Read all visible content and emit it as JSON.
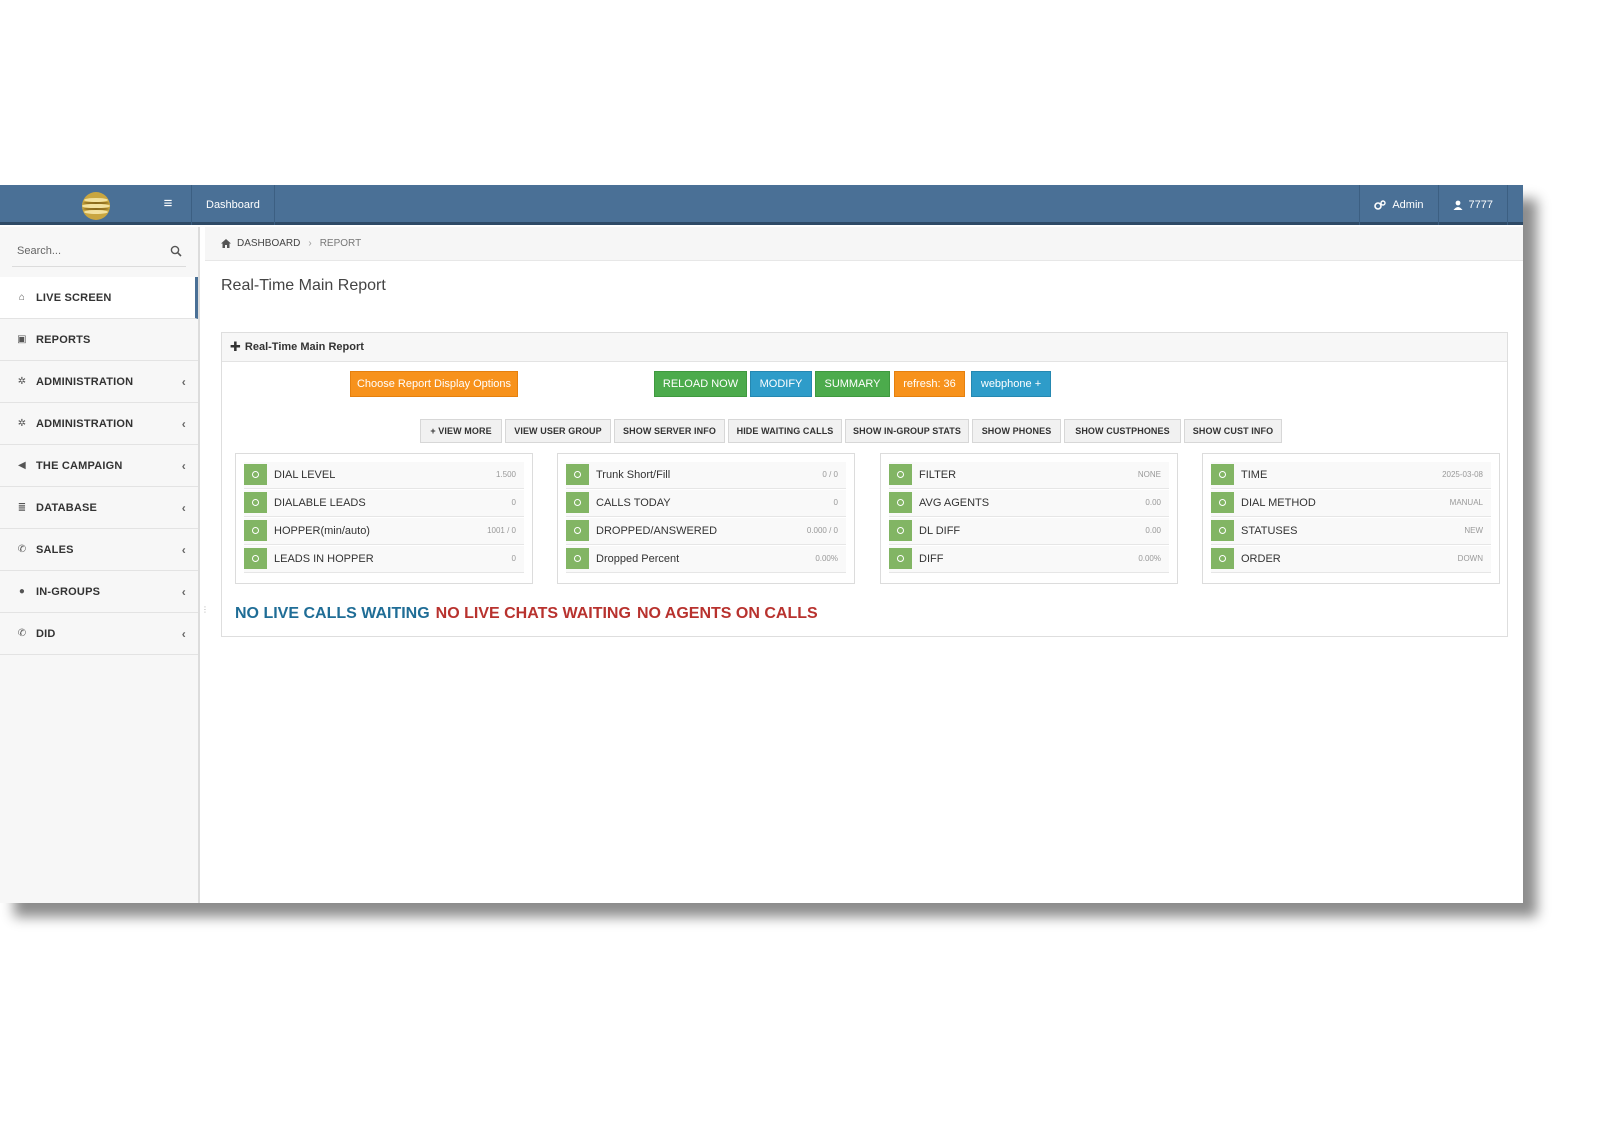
{
  "header": {
    "nav_dashboard": "Dashboard",
    "admin_label": "Admin",
    "user_label": "7777",
    "hamburger": "≡"
  },
  "sidebar": {
    "search_placeholder": "Search...",
    "items": [
      {
        "label": "LIVE SCREEN",
        "icon": "home-icon",
        "active": true,
        "chevron": false
      },
      {
        "label": "REPORTS",
        "icon": "image-icon",
        "active": false,
        "chevron": false
      },
      {
        "label": "ADMINISTRATION",
        "icon": "gear-icon",
        "active": false,
        "chevron": true
      },
      {
        "label": "ADMINISTRATION",
        "icon": "gear-icon",
        "active": false,
        "chevron": true
      },
      {
        "label": "THE CAMPAIGN",
        "icon": "bullhorn-icon",
        "active": false,
        "chevron": true
      },
      {
        "label": "DATABASE",
        "icon": "database-icon",
        "active": false,
        "chevron": true
      },
      {
        "label": "SALES",
        "icon": "phone-icon",
        "active": false,
        "chevron": true
      },
      {
        "label": "IN-GROUPS",
        "icon": "user-icon",
        "active": false,
        "chevron": true
      },
      {
        "label": "DID",
        "icon": "phone-icon",
        "active": false,
        "chevron": true
      }
    ]
  },
  "breadcrumb": {
    "home": "DASHBOARD",
    "current": "REPORT"
  },
  "page_title": "Real-Time Main Report",
  "panel": {
    "title": "Real-Time Main Report",
    "choose_options": "Choose Report Display Options",
    "reload_now": "RELOAD NOW",
    "modify": "MODIFY",
    "summary": "SUMMARY",
    "refresh": "refresh: 36",
    "webphone": "webphone +",
    "toggles": [
      "+ VIEW MORE",
      "VIEW USER GROUP",
      "SHOW SERVER INFO",
      "HIDE WAITING CALLS",
      "SHOW IN-GROUP STATS",
      "SHOW PHONES",
      "SHOW CUSTPHONES",
      "SHOW CUST INFO"
    ]
  },
  "stats": [
    [
      {
        "label": "DIAL LEVEL",
        "value": "1.500"
      },
      {
        "label": "DIALABLE LEADS",
        "value": "0"
      },
      {
        "label": "HOPPER(min/auto)",
        "value": "1001 / 0"
      },
      {
        "label": "LEADS IN HOPPER",
        "value": "0"
      }
    ],
    [
      {
        "label": "Trunk Short/Fill",
        "value": "0 / 0"
      },
      {
        "label": "CALLS TODAY",
        "value": "0"
      },
      {
        "label": "DROPPED/ANSWERED",
        "value": "0.000 / 0"
      },
      {
        "label": "Dropped Percent",
        "value": "0.00%"
      }
    ],
    [
      {
        "label": "FILTER",
        "value": "NONE"
      },
      {
        "label": "AVG AGENTS",
        "value": "0.00"
      },
      {
        "label": "DL DIFF",
        "value": "0.00"
      },
      {
        "label": "DIFF",
        "value": "0.00%"
      }
    ],
    [
      {
        "label": "TIME",
        "value": "2025-03-08"
      },
      {
        "label": "DIAL METHOD",
        "value": "MANUAL"
      },
      {
        "label": "STATUSES",
        "value": "NEW"
      },
      {
        "label": "ORDER",
        "value": "DOWN"
      }
    ]
  ],
  "status": {
    "calls": "NO LIVE CALLS WAITING",
    "chats": "NO LIVE CHATS WAITING",
    "agents": "NO AGENTS ON CALLS"
  },
  "colors": {
    "topbar": "#4a7096",
    "orange": "#f7921c",
    "green": "#4cab4c",
    "blue": "#2e9cc9",
    "stat_icon": "#82b564",
    "status_blue": "#1f6d96",
    "status_red": "#b8322e"
  }
}
